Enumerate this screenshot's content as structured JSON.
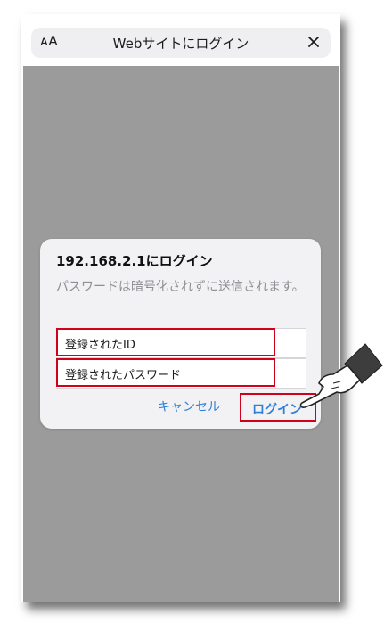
{
  "header": {
    "text_size_label": "ᴀA",
    "title": "Webサイトにログイン",
    "close_label": "×"
  },
  "dialog": {
    "title": "192.168.2.1にログイン",
    "message": "パスワードは暗号化されずに送信されます。",
    "username_value": "登録されたID",
    "password_value": "登録されたパスワード",
    "cancel_label": "キャンセル",
    "login_label": "ログイン"
  },
  "colors": {
    "accent": "#2f7fd8",
    "highlight": "#d0021b",
    "overlay": "#9b9b9b"
  },
  "icons": {
    "close": "close-icon",
    "pointer": "pointing-hand-icon"
  }
}
